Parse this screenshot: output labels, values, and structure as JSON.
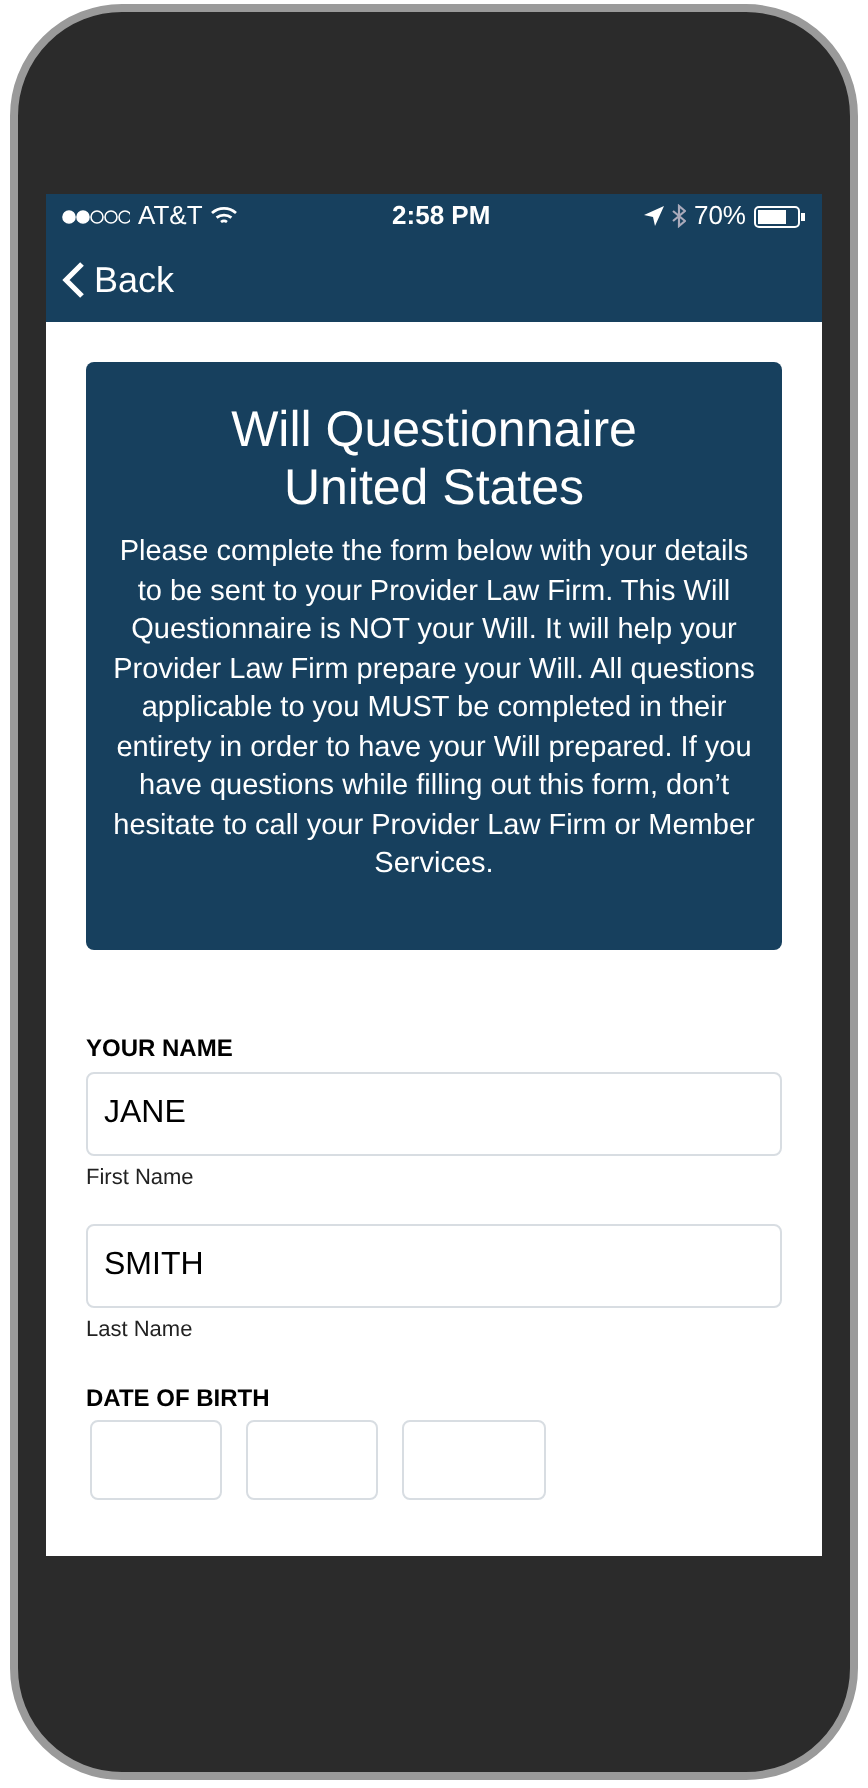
{
  "status_bar": {
    "carrier": "AT&T",
    "time": "2:58 PM",
    "battery": "70%"
  },
  "nav_bar": {
    "back": "Back"
  },
  "header_card": {
    "title_lines": [
      "Will Questionnaire",
      "United States"
    ],
    "description": "Please complete the form below with your details to be sent to your Provider Law Firm. This Will Questionnaire is NOT your Will. It will help your Provider Law Firm prepare your Will. All questions applicable to you MUST be completed in their entirety in order to have your Will prepared. If you have questions while filling out this form, don’t hesitate to call your Provider Law Firm or Member Services."
  },
  "your_name": {
    "label": "YOUR NAME",
    "fields": [
      {
        "value": "JANE",
        "caption": "First Name"
      },
      {
        "value": "SMITH",
        "caption": "Last Name"
      }
    ]
  },
  "date_of_birth": {
    "label": "DATE OF BIRTH",
    "fields": [
      {
        "kind": "small"
      },
      {
        "kind": "small"
      },
      {
        "kind": "large"
      }
    ]
  }
}
